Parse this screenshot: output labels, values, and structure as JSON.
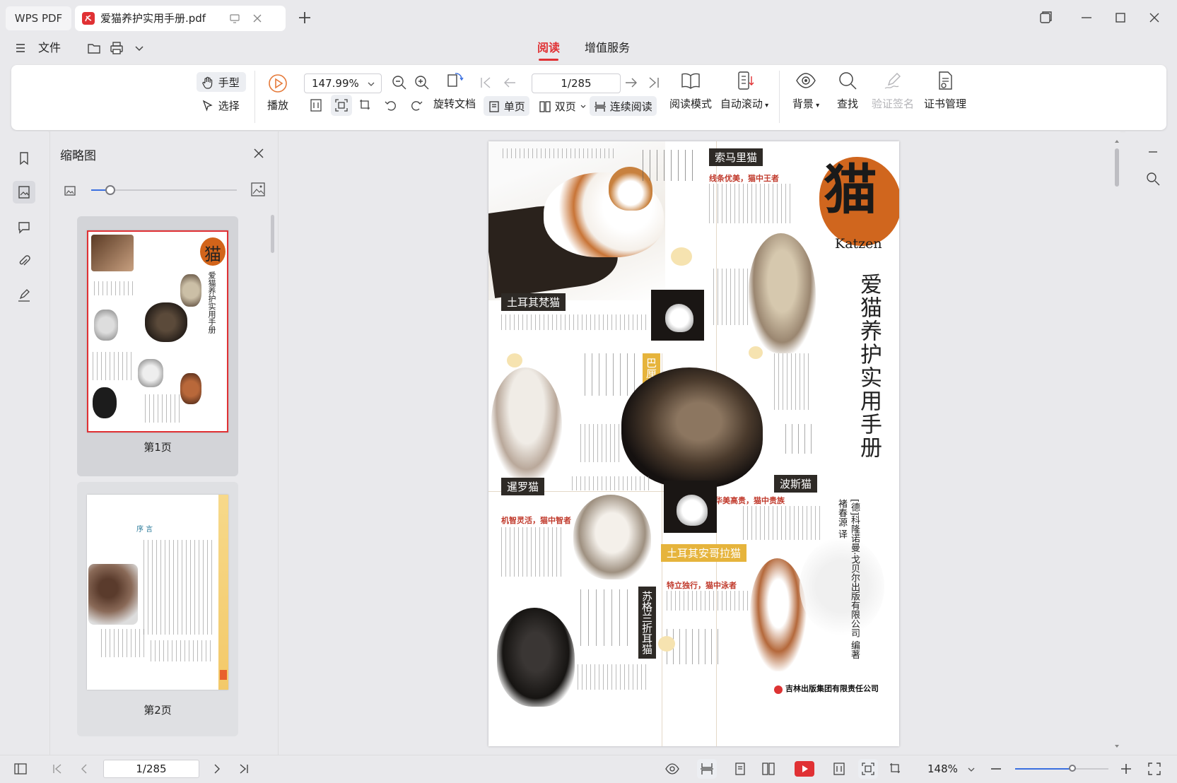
{
  "tabs": {
    "app_name": "WPS PDF",
    "doc_tab_title": "爱猫养护实用手册.pdf"
  },
  "menu": {
    "file_label": "文件",
    "tabs": [
      {
        "label": "阅读",
        "active": true
      },
      {
        "label": "增值服务",
        "active": false
      }
    ]
  },
  "toolbar": {
    "hand_label": "手型",
    "select_label": "选择",
    "play_label": "播放",
    "zoom_value": "147.99%",
    "page_value": "1/285",
    "rotate_doc_label": "旋转文档",
    "single_page_label": "单页",
    "double_page_label": "双页",
    "continuous_label": "连续阅读",
    "read_mode_label": "阅读模式",
    "auto_scroll_label": "自动滚动",
    "background_label": "背景",
    "find_label": "查找",
    "verify_sign_label": "验证签名",
    "cert_manage_label": "证书管理"
  },
  "thumbnail_panel": {
    "title": "缩略图",
    "pages": [
      {
        "label": "第1页",
        "selected": true
      },
      {
        "label": "第2页",
        "selected": false
      }
    ],
    "page2_heading": "序 言"
  },
  "page": {
    "label_turkish_van": "土耳其梵猫",
    "label_somali": "索马里猫",
    "somali_subtitle": "线条优美，猫中王者",
    "big_char": "猫",
    "katzen": "Katzen",
    "book_title": "爱猫养护实用手册",
    "label_balinese": "巴厘猫",
    "label_siamese": "暹罗猫",
    "siamese_subtitle": "机智灵活，猫中智者",
    "label_persian": "波斯猫",
    "persian_subtitle": "华美高贵，猫中贵族",
    "label_turkish_angora": "土耳其安哥拉猫",
    "angora_subtitle": "特立独行，猫中泳者",
    "label_scottish_fold": "苏格兰折耳猫",
    "translator": "褚春源 译",
    "author": "[德]科隆诺曼·戈贝尔出版有限公司 编著",
    "publisher": "吉林出版集团有限责任公司"
  },
  "statusbar": {
    "page_value": "1/285",
    "zoom_value": "148%",
    "zoom_fraction": 0.62
  },
  "colors": {
    "accent": "#e03134",
    "label_dark": "#2e2a26",
    "label_gold": "#e6b43c",
    "slider_blue": "#3a6fe0"
  }
}
